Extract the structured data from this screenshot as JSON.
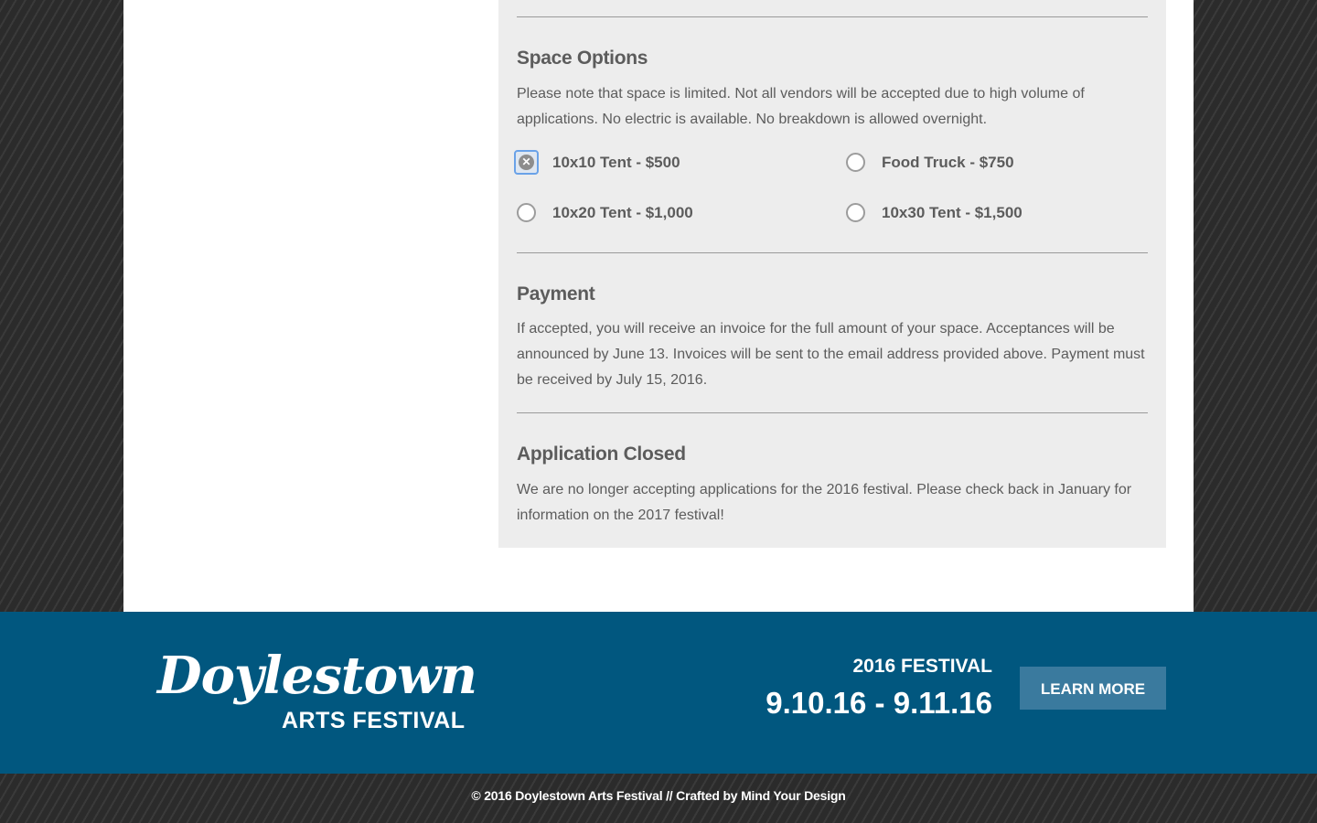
{
  "space_options": {
    "title": "Space Options",
    "note": "Please note that space is limited. Not all vendors will be accepted due to high volume of applications. No electric is available. No breakdown is allowed overnight.",
    "options": [
      {
        "label": "10x10 Tent - $500",
        "selected": true
      },
      {
        "label": "Food Truck - $750",
        "selected": false
      },
      {
        "label": "10x20 Tent - $1,000",
        "selected": false
      },
      {
        "label": "10x30 Tent - $1,500",
        "selected": false
      }
    ]
  },
  "payment": {
    "title": "Payment",
    "text": "If accepted, you will receive an invoice for the full amount of your space. Acceptances will be announced by June 13. Invoices will be sent to the email address provided above. Payment must be received by July 15, 2016."
  },
  "application_closed": {
    "title": "Application Closed",
    "text": "We are no longer accepting applications for the 2016 festival. Please check back in January for information on the 2017 festival!"
  },
  "footer": {
    "logo_script": "Doylestown",
    "logo_sub": "ARTS FESTIVAL",
    "festival_label": "2016 FESTIVAL",
    "festival_dates": "9.10.16 - 9.11.16",
    "learn_more": "LEARN MORE",
    "copyright": "© 2016 Doylestown Arts Festival // Crafted by Mind Your Design"
  },
  "colors": {
    "footer_band": "#01577f",
    "button": "#3a7a9e",
    "card": "#ededed"
  }
}
